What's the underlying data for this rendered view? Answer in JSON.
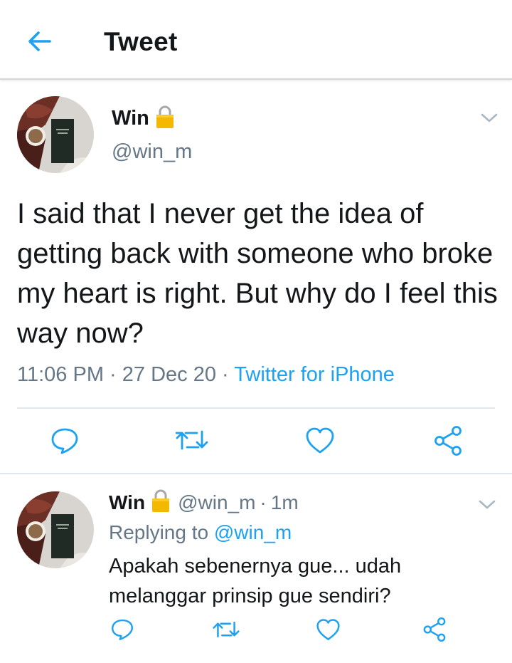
{
  "header": {
    "title": "Tweet",
    "back_icon": "arrow-left-icon"
  },
  "colors": {
    "accent": "#1da1f2",
    "text": "#14171a",
    "muted": "#657786",
    "divider": "#e1e8ed",
    "lock": "#f5b800"
  },
  "main_tweet": {
    "display_name": "Win",
    "handle": "@win_m",
    "text": "I said that I never get the idea of getting back with someone who broke my heart is right. But why do I feel this way now?",
    "time": "11:06 PM",
    "separator": "·",
    "date": "27 Dec 20",
    "source": "Twitter for iPhone",
    "actions": [
      "reply-icon",
      "retweet-icon",
      "like-icon",
      "share-icon"
    ]
  },
  "reply_tweet": {
    "display_name": "Win",
    "handle": "@win_m",
    "separator": "·",
    "age": "1m",
    "replying_label": "Replying to",
    "replying_to": "@win_m",
    "text": "Apakah sebenernya gue... udah melanggar prinsip gue sendiri?",
    "actions": [
      "reply-icon",
      "retweet-icon",
      "like-icon",
      "share-icon"
    ]
  }
}
